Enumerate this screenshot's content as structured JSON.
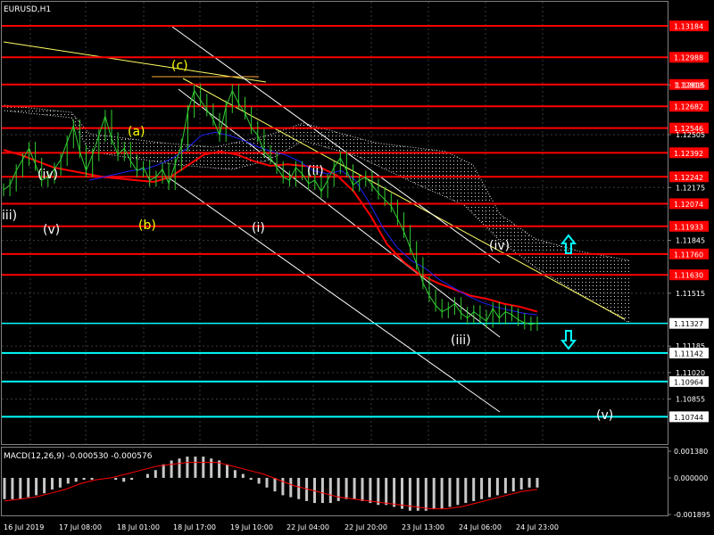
{
  "window": {
    "title": "EURUSD,H1"
  },
  "chart_data": {
    "type": "line",
    "symbol": "EURUSD",
    "timeframe": "H1",
    "ylim": [
      1.10635,
      1.13262
    ],
    "x_labels": [
      "16 Jul 2019",
      "17 Jul 08:00",
      "18 Jul 01:00",
      "18 Jul 17:00",
      "19 Jul 10:00",
      "22 Jul 04:00",
      "22 Jul 20:00",
      "23 Jul 13:00",
      "24 Jul 06:00",
      "24 Jul 23:00"
    ],
    "y_ticks": [
      "1.12815",
      "1.12505",
      "1.12175",
      "1.11845",
      "1.11515",
      "1.11185",
      "1.11020",
      "1.10855"
    ],
    "current_price": "1.11327",
    "resistance_levels": [
      "1.13184",
      "1.12988",
      "1.12818",
      "1.12682",
      "1.12546",
      "1.12392",
      "1.12242",
      "1.12074",
      "1.11933",
      "1.11760",
      "1.11630"
    ],
    "support_levels": [
      "1.11142",
      "1.10964",
      "1.10744"
    ],
    "colors": {
      "background": "#000000",
      "price": "#32CD32",
      "grid": "#3a3a3a",
      "resistance": "#FF0000",
      "support": "#00FFFF",
      "ma": "#FF0000",
      "ma2": "#2020FF",
      "trendline": "#FFFF66",
      "channel": "#FFFFFF",
      "wave_white": "#FFFFFF",
      "wave_yellow": "#FFFF00",
      "up_arrow": "#00FFFF"
    },
    "price_close": [
      1.1216,
      1.1219,
      1.1228,
      1.1235,
      1.1242,
      1.1232,
      1.1222,
      1.1224,
      1.1229,
      1.1235,
      1.1246,
      1.1256,
      1.124,
      1.1228,
      1.1238,
      1.125,
      1.1262,
      1.1248,
      1.1238,
      1.1242,
      1.1234,
      1.1228,
      1.123,
      1.1222,
      1.1224,
      1.1229,
      1.122,
      1.1232,
      1.1244,
      1.1265,
      1.1278,
      1.1272,
      1.1266,
      1.126,
      1.125,
      1.1268,
      1.1278,
      1.127,
      1.1264,
      1.1255,
      1.125,
      1.124,
      1.1236,
      1.123,
      1.1224,
      1.1222,
      1.123,
      1.1226,
      1.122,
      1.1222,
      1.1215,
      1.1222,
      1.123,
      1.1236,
      1.1228,
      1.1219,
      1.1222,
      1.1224,
      1.1219,
      1.1214,
      1.121,
      1.1206,
      1.1198,
      1.119,
      1.118,
      1.117,
      1.1158,
      1.115,
      1.1144,
      1.114,
      1.1142,
      1.1145,
      1.1139,
      1.1136,
      1.114,
      1.1137,
      1.1134,
      1.1142,
      1.1136,
      1.114,
      1.1138,
      1.1135,
      1.1133,
      1.1132,
      1.1133
    ],
    "ma_red": [
      1.1241,
      1.1238,
      1.1234,
      1.123,
      1.1228,
      1.1226,
      1.1224,
      1.1223,
      1.1222,
      1.1221,
      1.1224,
      1.1231,
      1.1238,
      1.124,
      1.1238,
      1.1234,
      1.1231,
      1.1232,
      1.1231,
      1.123,
      1.1225,
      1.1215,
      1.12,
      1.1182,
      1.1171,
      1.1163,
      1.1158,
      1.1154,
      1.115,
      1.1148,
      1.1145,
      1.1143,
      1.114
    ],
    "ma_blue": [
      1.1222,
      1.1224,
      1.1226,
      1.1228,
      1.1229,
      1.1232,
      1.1236,
      1.1242,
      1.125,
      1.1252,
      1.125,
      1.1247,
      1.1243,
      1.124,
      1.1238,
      1.1234,
      1.1228,
      1.1226,
      1.1228,
      1.1222,
      1.1208,
      1.1192,
      1.118,
      1.1172,
      1.1167,
      1.116,
      1.1155,
      1.115,
      1.1146,
      1.1143,
      1.1141,
      1.1139,
      1.1138
    ],
    "macd": {
      "label": "MACD(12,26,9) -0.000530 -0.000576",
      "y_ticks": [
        "0.001380",
        "0.000000",
        "-0.001895"
      ],
      "ylim": [
        -0.001895,
        0.00138
      ],
      "histogram": [
        -0.0011,
        -0.0011,
        -0.0011,
        -0.001,
        -0.0009,
        -0.0008,
        -0.0006,
        -0.0005,
        -0.0003,
        -0.0002,
        -0.0001,
        -0.0001,
        0.0,
        0.0,
        -0.0001,
        -0.0002,
        -0.0001,
        0.0,
        0.0002,
        0.0004,
        0.0007,
        0.0009,
        0.001,
        0.0011,
        0.0011,
        0.0011,
        0.001,
        0.0009,
        0.0007,
        0.0004,
        0.0002,
        -0.0001,
        -0.0003,
        -0.0005,
        -0.0007,
        -0.0009,
        -0.001,
        -0.0011,
        -0.0012,
        -0.0013,
        -0.0013,
        -0.0013,
        -0.0012,
        -0.0011,
        -0.0011,
        -0.0012,
        -0.0013,
        -0.0014,
        -0.0014,
        -0.0015,
        -0.0016,
        -0.0017,
        -0.0017,
        -0.0017,
        -0.0016,
        -0.0016,
        -0.0015,
        -0.0014,
        -0.0013,
        -0.0012,
        -0.0011,
        -0.001,
        -0.0009,
        -0.0008,
        -0.0007,
        -0.0006,
        -0.0005,
        -0.0005
      ],
      "signal": [
        -0.0012,
        -0.0011,
        -0.001,
        -0.0008,
        -0.0006,
        -0.0003,
        -0.0001,
        0.0,
        0.0002,
        0.0004,
        0.0006,
        0.0007,
        0.0008,
        0.0008,
        0.0008,
        0.0006,
        0.0004,
        0.0002,
        -0.0001,
        -0.0004,
        -0.0006,
        -0.0008,
        -0.001,
        -0.0011,
        -0.0012,
        -0.0013,
        -0.0014,
        -0.0015,
        -0.0016,
        -0.0016,
        -0.0015,
        -0.0013,
        -0.0011,
        -0.0009,
        -0.0007,
        -0.0006
      ]
    },
    "waves": {
      "c": "(c)",
      "a": "(a)",
      "b": "(b)",
      "iv_left": "(iv)",
      "v_left": "(v)",
      "iii_left": "iii)",
      "i": "(i)",
      "ii": "(ii)",
      "iii": "(iii)",
      "iv": "(iv)",
      "v": "(v)"
    }
  }
}
